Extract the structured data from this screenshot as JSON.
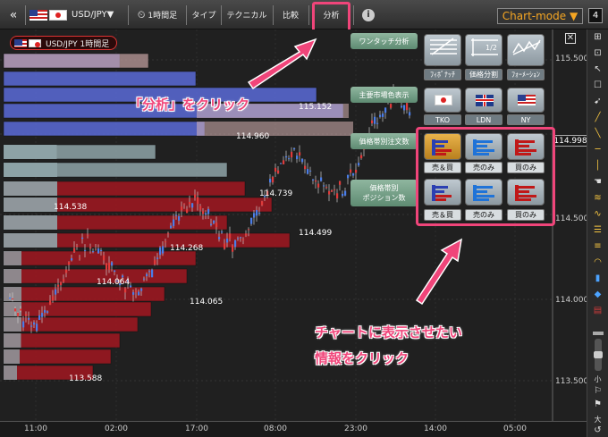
{
  "toolbar": {
    "back_icon": "double-chevron-left-icon",
    "pair": "USD/JPY▼",
    "timeframe": "1時間足",
    "type": "タイプ",
    "technical": "テクニカル",
    "compare": "比較",
    "analysis": "分析",
    "info_icon": "info-icon",
    "chart_mode": "Chart-mode ▼",
    "page": "4"
  },
  "chart": {
    "badge": "USD/JPY 1時間足",
    "current_price": "114.998",
    "price_axis": [
      "115.500",
      "115.000",
      "114.500",
      "114.000",
      "113.500"
    ],
    "levels": [
      "115.152",
      "114.960",
      "114.739",
      "114.538",
      "114.499",
      "114.268",
      "114.064",
      "114.065",
      "113.588"
    ],
    "time_axis": [
      "11:00",
      "02:00",
      "17:00",
      "08:00",
      "23:00",
      "14:00",
      "05:00"
    ],
    "colors": {
      "sell_bar": "#5a6bd8",
      "buy_bar": "#9b1820",
      "neutral_bar": "#8fa4a8",
      "accent": "#f0457a"
    }
  },
  "panel": {
    "one_touch": "ワンタッチ分析",
    "major_markets": "主要市場色表示",
    "order_book_1": "価格帯別注文数",
    "position_book_1": "価格帯別",
    "position_book_2": "ポジション数",
    "fibonacci": "ﾌｨﾎﾞﾅｯﾁ",
    "price_split": "価格分割",
    "formation": "ﾌｫｰﾒｰｼｮﾝ",
    "half": "1/2",
    "tko": "TKO",
    "ldn": "LDN",
    "ny": "NY",
    "both": "売＆買",
    "sell_only": "売のみ",
    "buy_only": "買のみ"
  },
  "callouts": {
    "click_analysis": "「分析」をクリック",
    "click_info_1": "チャートに表示させたい",
    "click_info_2": "情報をクリック"
  },
  "right_tools": {
    "small_label": "小",
    "large_label": "大"
  }
}
